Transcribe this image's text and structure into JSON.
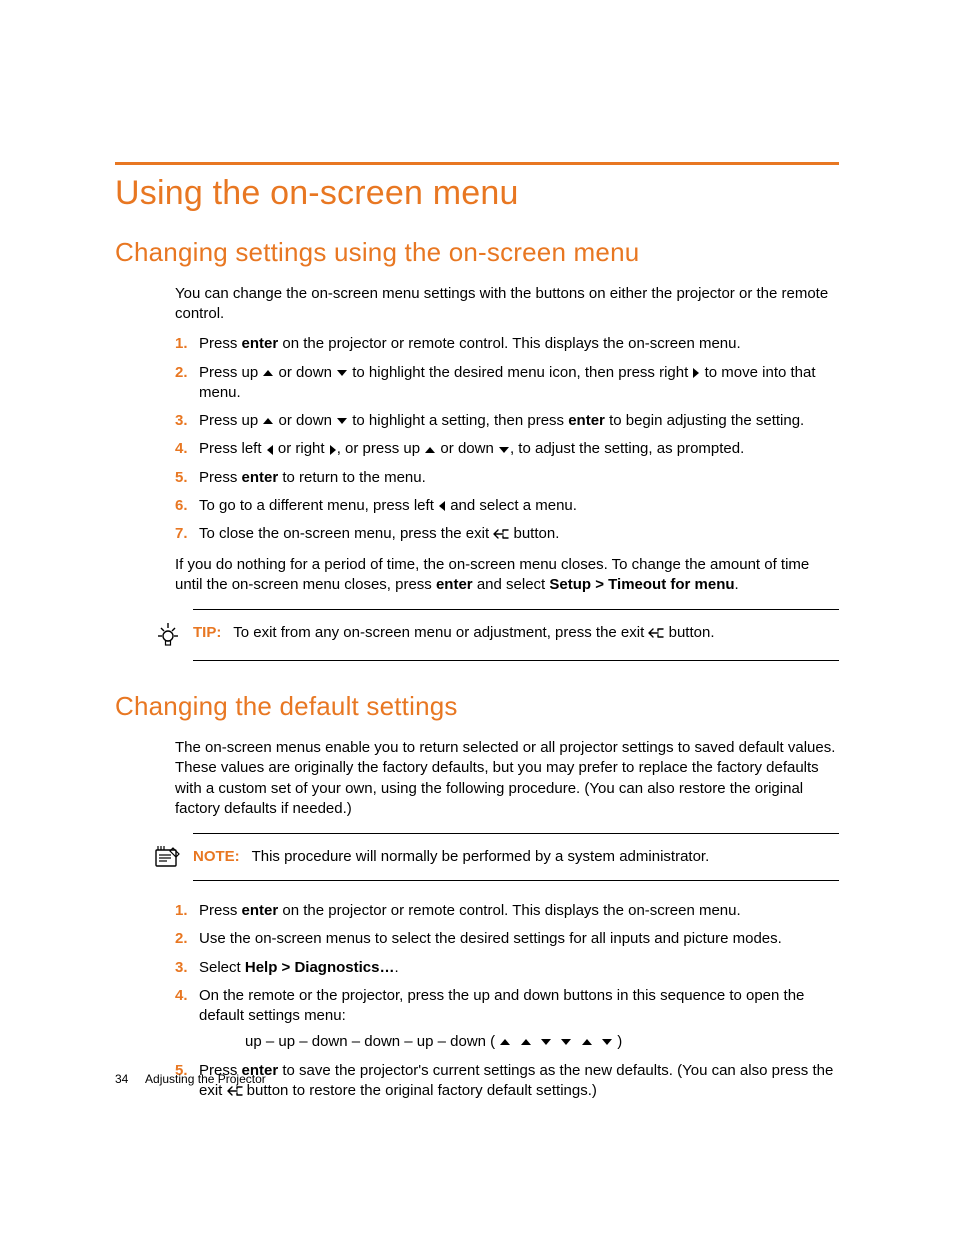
{
  "heading_main": "Using the on-screen menu",
  "section1": {
    "heading": "Changing settings using the on-screen menu",
    "intro": "You can change the on-screen menu settings with the buttons on either the projector or the remote control.",
    "steps": {
      "s1a": "Press ",
      "s1b": "enter",
      "s1c": " on the projector or remote control. This displays the on-screen menu.",
      "s2a": "Press up ",
      "s2b": " or down ",
      "s2c": " to highlight the desired menu icon, then press right ",
      "s2d": " to move into that menu.",
      "s3a": "Press up ",
      "s3b": " or down ",
      "s3c": " to highlight a setting, then press ",
      "s3d": "enter",
      "s3e": " to begin adjusting the setting.",
      "s4a": "Press left ",
      "s4b": " or right ",
      "s4c": ", or press up ",
      "s4d": " or down ",
      "s4e": ", to adjust the setting, as prompted.",
      "s5a": "Press ",
      "s5b": "enter",
      "s5c": " to return to the menu.",
      "s6a": "To go to a different menu, press left ",
      "s6b": " and select a menu.",
      "s7a": "To close the on-screen menu, press the exit ",
      "s7b": " button."
    },
    "after_a": "If you do nothing for a period of time, the on-screen menu closes. To change the amount of time until the on-screen menu closes, press ",
    "after_b": "enter",
    "after_c": " and select ",
    "after_d": "Setup > Timeout for menu",
    "after_e": ".",
    "tip_label": "TIP:",
    "tip_a": "To exit from any on-screen menu or adjustment, press the exit ",
    "tip_b": " button."
  },
  "section2": {
    "heading": "Changing the default settings",
    "intro": "The on-screen menus enable you to return selected or all projector settings to saved default values. These values are originally the factory defaults, but you may prefer to replace the factory defaults with a custom set of your own, using the following procedure. (You can also restore the original factory defaults if needed.)",
    "note_label": "NOTE:",
    "note_body": "This procedure will normally be performed by a system administrator.",
    "steps": {
      "s1a": "Press ",
      "s1b": "enter",
      "s1c": " on the projector or remote control. This displays the on-screen menu.",
      "s2": "Use the on-screen menus to select the desired settings for all inputs and picture modes.",
      "s3a": "Select ",
      "s3b": "Help > Diagnostics…",
      "s3c": ".",
      "s4": "On the remote or the projector, press the up and down buttons in this sequence to open the default settings menu:",
      "s4seq_a": "up – up – down – down – up – down ( ",
      "s4seq_b": " )",
      "s5a": "Press ",
      "s5b": "enter",
      "s5c": " to save the projector's current settings as the new defaults. (You can also press the exit ",
      "s5d": " button to restore the original factory default settings.)"
    }
  },
  "footer": {
    "page_number": "34",
    "chapter": "Adjusting the Projector"
  }
}
